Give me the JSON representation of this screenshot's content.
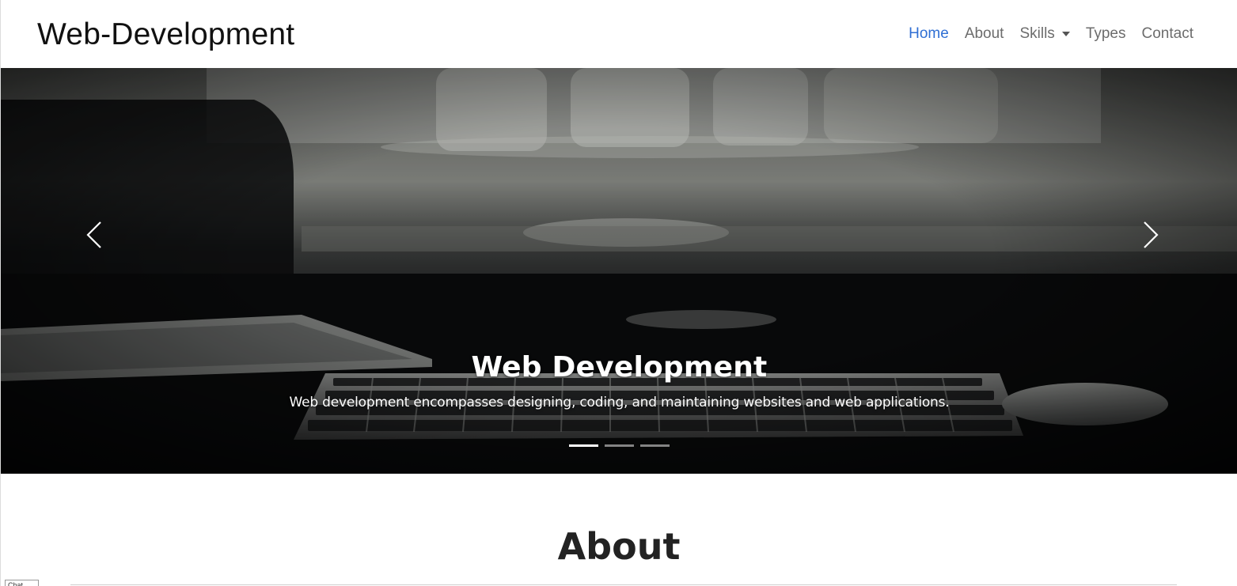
{
  "brand": "Web-Development",
  "nav": {
    "items": [
      {
        "label": "Home",
        "active": true
      },
      {
        "label": "About"
      },
      {
        "label": "Skills",
        "dropdown": true
      },
      {
        "label": "Types"
      },
      {
        "label": "Contact"
      }
    ]
  },
  "carousel": {
    "title": "Web Development",
    "text": "Web development encompasses designing, coding, and maintaining websites and web applications.",
    "slides": 3,
    "active_slide": 1,
    "prev_icon": "chevron-left-icon",
    "next_icon": "chevron-right-icon"
  },
  "about": {
    "heading": "About"
  },
  "corner_box_text": "Chat",
  "colors": {
    "active_link": "#2f6fd4",
    "nav_link": "#6c6c6c"
  }
}
